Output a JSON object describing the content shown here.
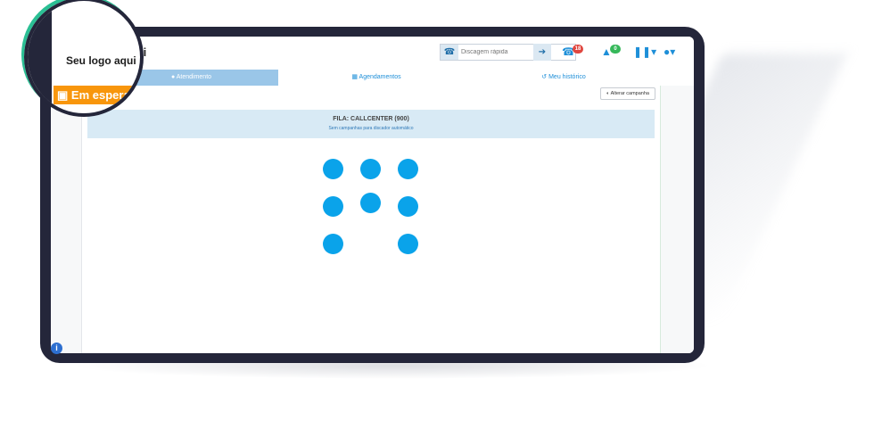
{
  "logo": {
    "text": "Seu logo aqui"
  },
  "waiting_button": {
    "label": "Em espera"
  },
  "quick_dial": {
    "placeholder": "Discagem rápida"
  },
  "header_badges": {
    "calls": "18",
    "alerts": "0"
  },
  "tabs": [
    {
      "label": "Atendimento",
      "icon": "user-headset-icon",
      "active": true
    },
    {
      "label": "Agendamentos",
      "icon": "calendar-icon",
      "active": false
    },
    {
      "label": "Meu histórico",
      "icon": "history-icon",
      "active": false
    }
  ],
  "switch_campaign": {
    "label": "Alterar campanha"
  },
  "queue": {
    "title": "FILA: CALLCENTER (900)",
    "subtitle": "Sem campanhas para discador automático"
  },
  "colors": {
    "accent": "#1e8fd8",
    "dot": "#0aa3ea",
    "waiting": "#f8960c",
    "queue_bg": "#d8eaf5",
    "frame": "#24263a",
    "highlight": "#2bbf94"
  }
}
